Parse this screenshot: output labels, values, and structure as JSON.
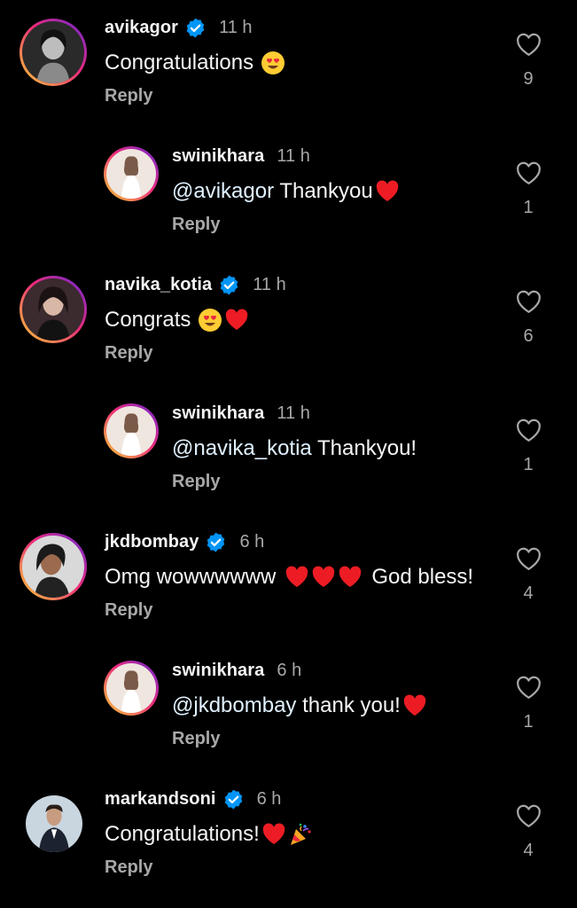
{
  "colors": {
    "background": "#000000",
    "text": "#f5f5f5",
    "secondary": "#a8a8a8",
    "verified": "#0095f6",
    "heart": "#ed1c24",
    "mention": "#e0f1ff"
  },
  "comments": [
    {
      "username": "avikagor",
      "verified": true,
      "time": "11 h",
      "text": "Congratulations",
      "emojis": [
        "heart-eyes-emoji"
      ],
      "reply_label": "Reply",
      "likes": "9",
      "is_reply": false
    },
    {
      "username": "swinikhara",
      "verified": false,
      "time": "11 h",
      "mention": "@avikagor",
      "text": " Thankyou",
      "emojis": [
        "red-heart-emoji"
      ],
      "reply_label": "Reply",
      "likes": "1",
      "is_reply": true
    },
    {
      "username": "navika_kotia",
      "verified": true,
      "time": "11 h",
      "text": "Congrats",
      "emojis": [
        "heart-eyes-emoji",
        "red-heart-emoji"
      ],
      "reply_label": "Reply",
      "likes": "6",
      "is_reply": false
    },
    {
      "username": "swinikhara",
      "verified": false,
      "time": "11 h",
      "mention": "@navika_kotia",
      "text": " Thankyou!",
      "emojis": [],
      "reply_label": "Reply",
      "likes": "1",
      "is_reply": true
    },
    {
      "username": "jkdbombay",
      "verified": true,
      "time": "6 h",
      "text": "Omg wowwwwww",
      "emojis": [
        "red-heart-emoji",
        "red-heart-emoji",
        "red-heart-emoji"
      ],
      "text_after": "God bless!",
      "reply_label": "Reply",
      "likes": "4",
      "is_reply": false
    },
    {
      "username": "swinikhara",
      "verified": false,
      "time": "6 h",
      "mention": "@jkdbombay",
      "text": " thank you!",
      "emojis": [
        "red-heart-emoji"
      ],
      "reply_label": "Reply",
      "likes": "1",
      "is_reply": true
    },
    {
      "username": "markandsoni",
      "verified": true,
      "time": "6 h",
      "text": "Congratulations!",
      "emojis": [
        "red-heart-emoji",
        "party-popper-emoji"
      ],
      "reply_label": "Reply",
      "likes": "4",
      "is_reply": false
    }
  ]
}
